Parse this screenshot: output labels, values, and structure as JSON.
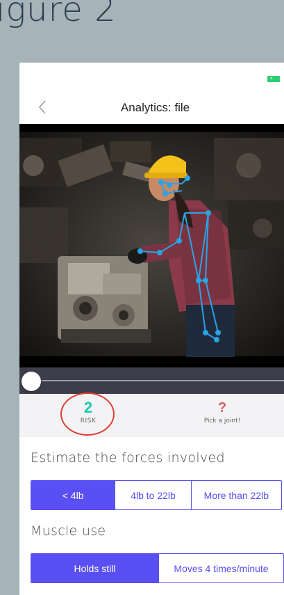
{
  "figure": {
    "title": "igure 2"
  },
  "status_bar": {
    "battery_icon": "battery-charging-icon",
    "battery_color": "#2ecc71"
  },
  "nav": {
    "back_icon": "chevron-left-icon",
    "title": "Analytics: file"
  },
  "video": {
    "scrubber_position": 0.0
  },
  "metrics": {
    "risk_value": "2",
    "risk_label": "RISK",
    "risk_color": "#1ec8b0",
    "joint_symbol": "?",
    "joint_label": "Pick a joint!",
    "highlight_color": "#e03c2e"
  },
  "forces": {
    "title": "Estimate the forces involved",
    "options": [
      "< 4lb",
      "4lb to 22lb",
      "More than 22lb"
    ],
    "selected": 0
  },
  "muscle": {
    "title": "Muscle use",
    "options": [
      "Holds still",
      "Moves 4 times/minute"
    ],
    "selected": 0
  },
  "accent_color": "#5a4ff3"
}
